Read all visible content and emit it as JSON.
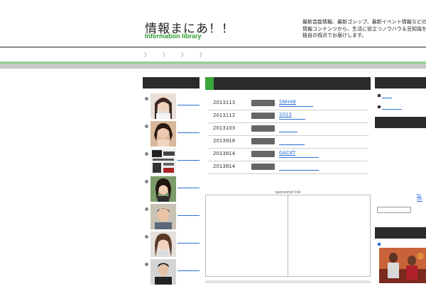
{
  "header": {
    "title": "情報まにあ！！",
    "subtitle": "Information library",
    "description_lines": [
      "最新芸能情報、最新ゴシップ、最新イベント情報などの",
      "情報コンテンツから、生活に役立つノウハウ＆豆知識を",
      "独自の視点でお届けします。"
    ]
  },
  "nav": {
    "arrows": [
      "〉",
      "〉",
      "〉",
      "〉"
    ]
  },
  "news": [
    {
      "date": "2013113",
      "title": "SNH48"
    },
    {
      "date": "2013112",
      "title": "2013"
    },
    {
      "date": "2013103",
      "title": ""
    },
    {
      "date": "2013918",
      "title": ""
    },
    {
      "date": "2013814",
      "title": "GACKT"
    },
    {
      "date": "2013814",
      "title": ""
    }
  ],
  "sponsored_label": "sponsored link",
  "right": {
    "small_link": "by GH",
    "search_button": ""
  },
  "colors": {
    "accent_green": "#3aa53a",
    "link_blue": "#2a6fd6",
    "dark_bar": "#2b2b2b"
  }
}
